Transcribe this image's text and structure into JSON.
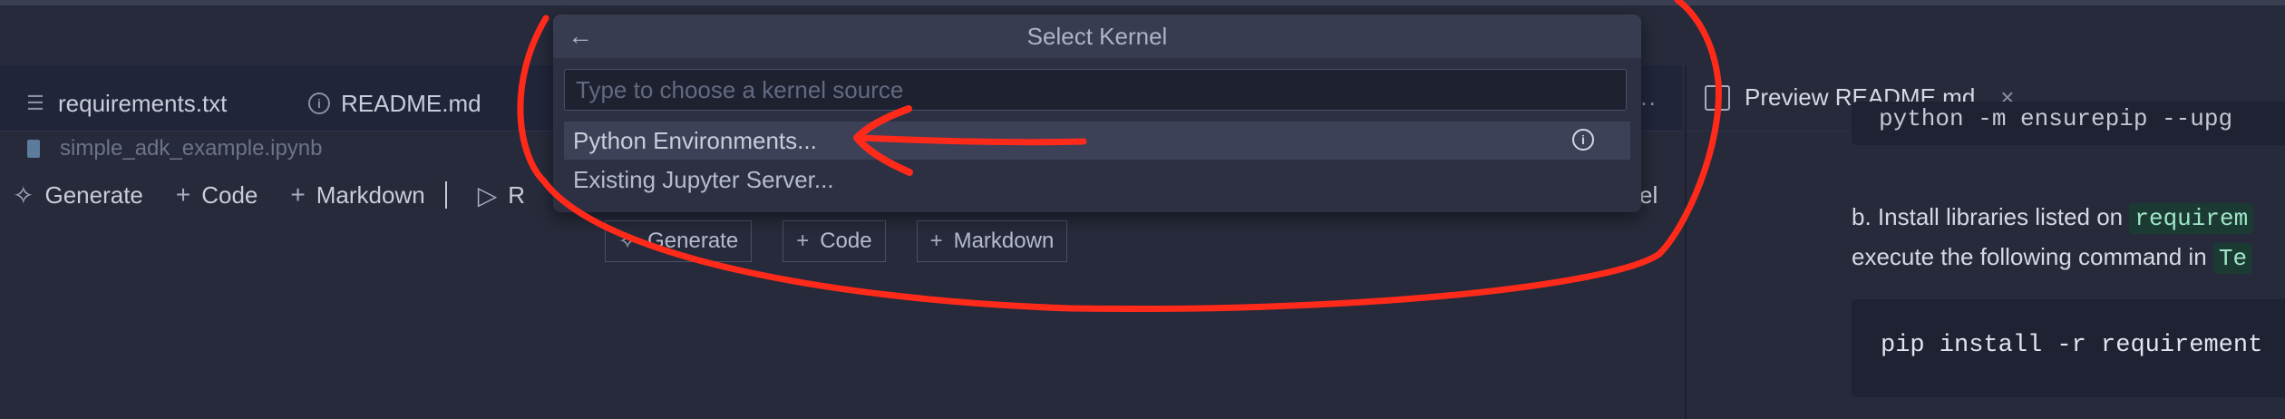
{
  "editor": {
    "tabs": [
      {
        "label": "requirements.txt",
        "icon": "lines-icon"
      },
      {
        "label": "README.md",
        "icon": "info-icon"
      }
    ],
    "more_label": "...",
    "breadcrumb": "simple_adk_example.ipynb",
    "toolbar": {
      "generate": "Generate",
      "code": "Code",
      "markdown": "Markdown",
      "run_partial": "R",
      "kernel_partial": "el"
    },
    "cell_actions": {
      "generate": "Generate",
      "code": "Code",
      "markdown": "Markdown"
    }
  },
  "preview": {
    "tab_label": "Preview README.md",
    "close": "×",
    "code_top": "python -m ensurepip --upg",
    "para1_text": "b. Install libraries listed on ",
    "para1_code": "requirem",
    "para2_text": "execute the following command in ",
    "para2_code": "Te",
    "code_block": "pip install -r requirement"
  },
  "quick_pick": {
    "title": "Select Kernel",
    "back": "←",
    "placeholder": "Type to choose a kernel source",
    "items": [
      {
        "label": "Python Environments...",
        "selected": true
      },
      {
        "label": "Existing Jupyter Server...",
        "selected": false
      }
    ]
  },
  "colors": {
    "background": "#262a3a",
    "annotation": "#ff2a1a",
    "inline_code": "#9fe6c8"
  }
}
